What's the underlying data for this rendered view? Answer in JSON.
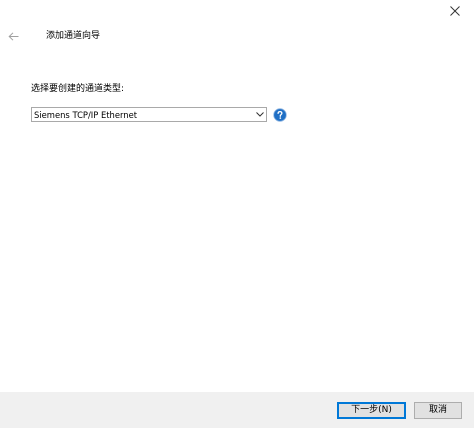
{
  "window": {
    "title": "添加通道向导"
  },
  "icons": {
    "close": "close-icon",
    "back": "back-arrow-icon",
    "dropdown": "chevron-down-icon",
    "help": "help-icon"
  },
  "colors": {
    "accent": "#0078d7",
    "help_blue": "#1f6fc5",
    "footer_bg": "#f0f0f0"
  },
  "form": {
    "prompt": "选择要创建的通道类型:",
    "channel_type_selected": "Siemens TCP/IP Ethernet"
  },
  "footer": {
    "next_label": "下一步(N)",
    "cancel_label": "取消"
  }
}
